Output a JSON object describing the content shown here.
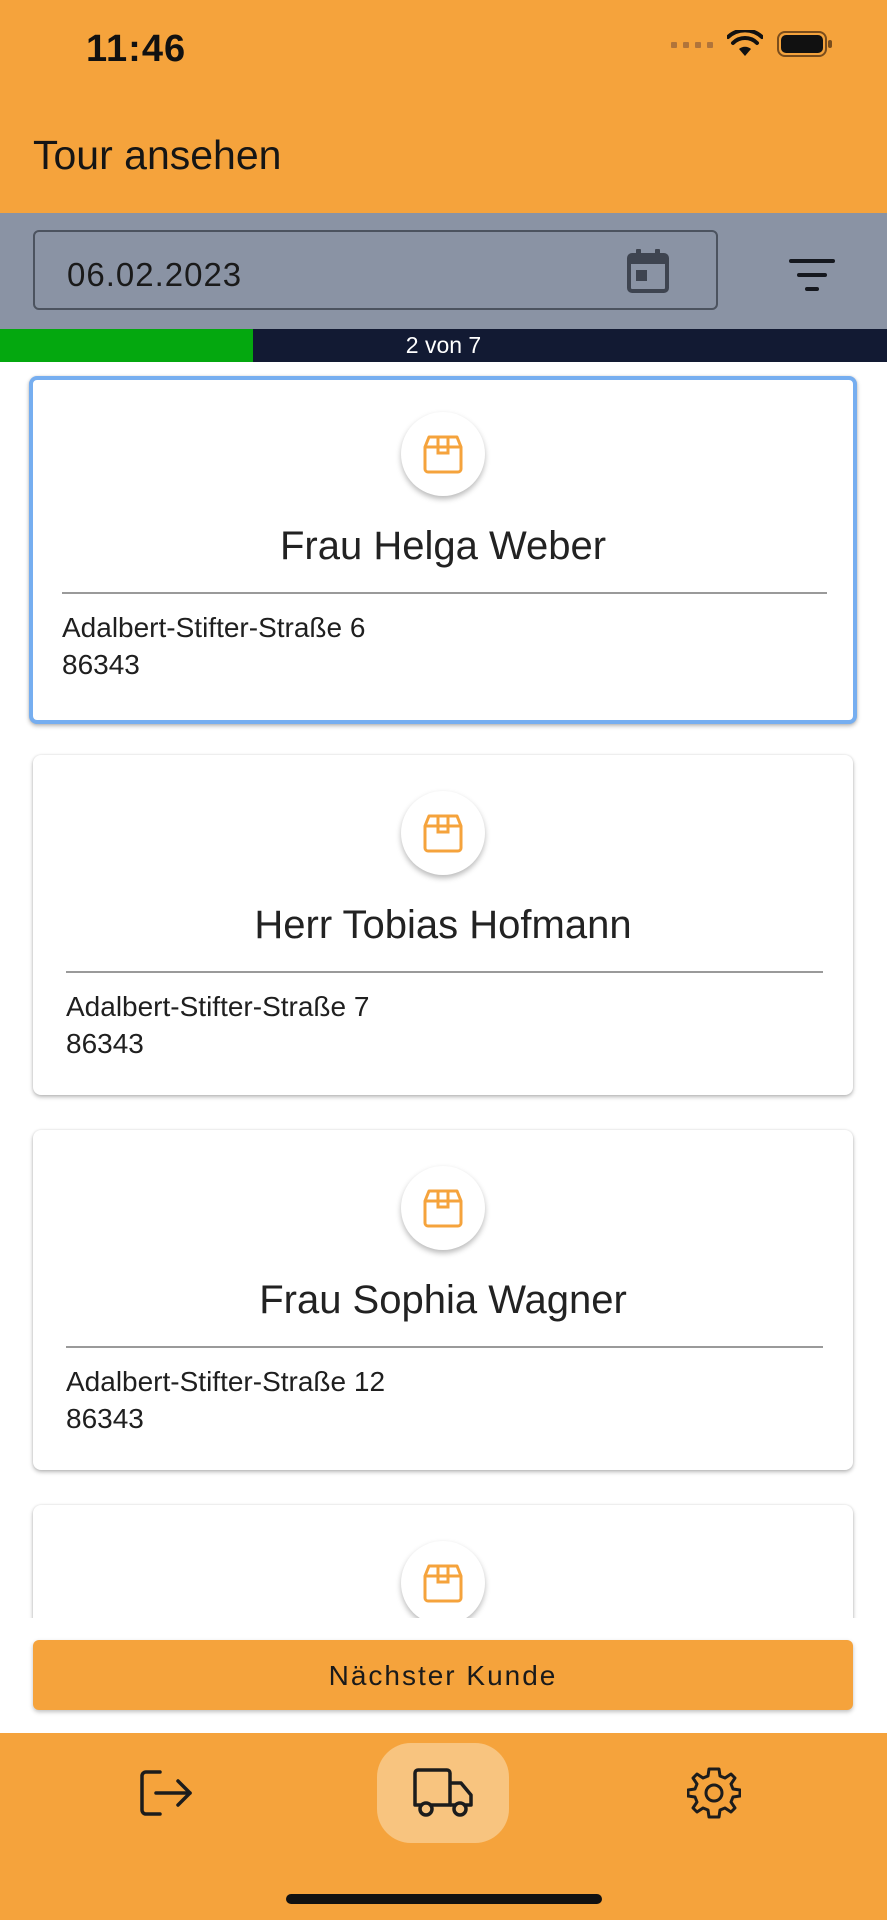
{
  "status_bar": {
    "time": "11:46"
  },
  "header": {
    "title": "Tour ansehen"
  },
  "filter_bar": {
    "date_value": "06.02.2023"
  },
  "progress": {
    "label": "2 von 7",
    "fraction": 0.2857
  },
  "customers": [
    {
      "name": "Frau Helga Weber",
      "street": "Adalbert-Stifter-Straße 6",
      "zip": "86343",
      "selected": true
    },
    {
      "name": "Herr Tobias Hofmann",
      "street": "Adalbert-Stifter-Straße 7",
      "zip": "86343",
      "selected": false
    },
    {
      "name": "Frau Sophia Wagner",
      "street": "Adalbert-Stifter-Straße 12",
      "zip": "86343",
      "selected": false
    },
    {
      "name": "",
      "street": "",
      "zip": "",
      "selected": false
    }
  ],
  "actions": {
    "next_customer_label": "Nächster Kunde"
  },
  "bottom_nav": {
    "items": [
      {
        "icon": "logout-icon",
        "active": false
      },
      {
        "icon": "truck-icon",
        "active": true
      },
      {
        "icon": "gear-icon",
        "active": false
      }
    ]
  },
  "colors": {
    "brand_orange": "#f5a33c",
    "toolbar_gray": "#8a93a4",
    "progress_green": "#04a80f",
    "progress_track": "#121a33",
    "selected_border": "#76aef0",
    "package_icon": "#f5a33c"
  }
}
